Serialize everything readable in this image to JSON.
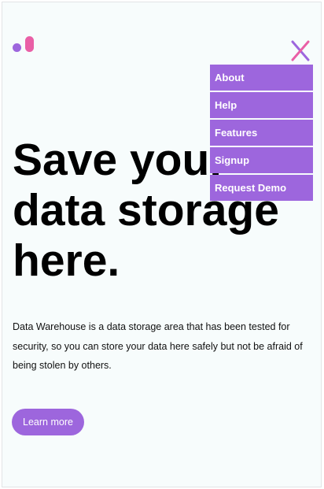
{
  "header": {
    "logo_icon": "brand-logo-icon",
    "close_icon": "close-icon"
  },
  "nav": {
    "items": [
      {
        "label": "About"
      },
      {
        "label": "Help"
      },
      {
        "label": "Features"
      },
      {
        "label": "Signup"
      },
      {
        "label": "Request Demo"
      }
    ]
  },
  "hero": {
    "title": "Save your data storage here.",
    "description": "Data Warehouse is a data storage area that has been tested for security, so you can store your data here safely but not be afraid of being stolen by others.",
    "cta_label": "Learn more"
  },
  "colors": {
    "accent": "#9d66dd",
    "accent_pink": "#e95fa6",
    "background": "#f7fcfc",
    "text": "#000000"
  }
}
